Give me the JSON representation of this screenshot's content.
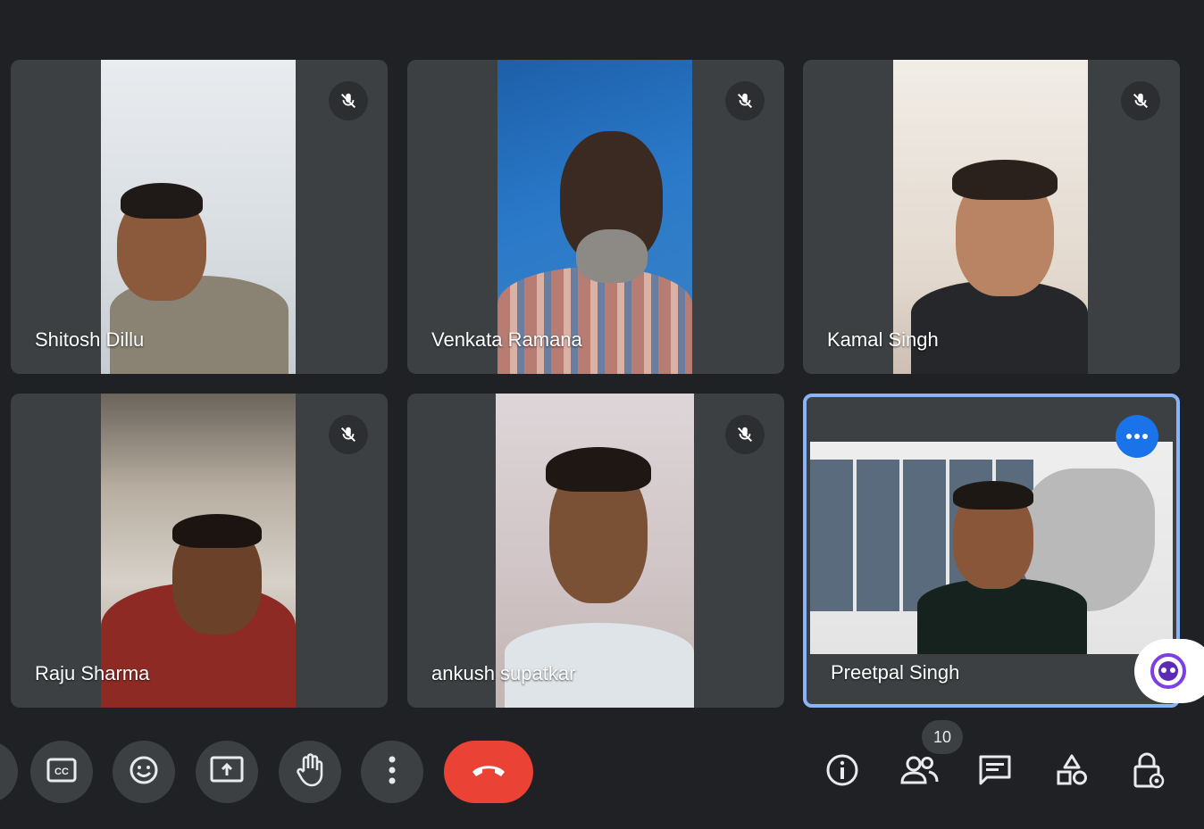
{
  "participants": [
    {
      "name": "Shitosh Dillu"
    },
    {
      "name": "Venkata Ramana"
    },
    {
      "name": "Kamal Singh"
    },
    {
      "name": "Raju Sharma"
    },
    {
      "name": "ankush supatkar"
    },
    {
      "name": "Preetpal Singh"
    }
  ],
  "people_count": "10",
  "colors": {
    "background": "#202124",
    "tile": "#3c4043",
    "end_call": "#ea4335",
    "active_border": "#8ab4f8",
    "accent": "#1a73e8"
  },
  "icons": {
    "mic_off": "mic-off-icon",
    "more_options": "more-options-icon",
    "captions": "closed-captions-icon",
    "emoji": "emoji-icon",
    "present": "present-screen-icon",
    "raise_hand": "raise-hand-icon",
    "more": "more-vert-icon",
    "end_call": "call-end-icon",
    "info": "info-icon",
    "people": "people-icon",
    "chat": "chat-icon",
    "activities": "activities-icon",
    "host_controls": "host-controls-icon"
  }
}
